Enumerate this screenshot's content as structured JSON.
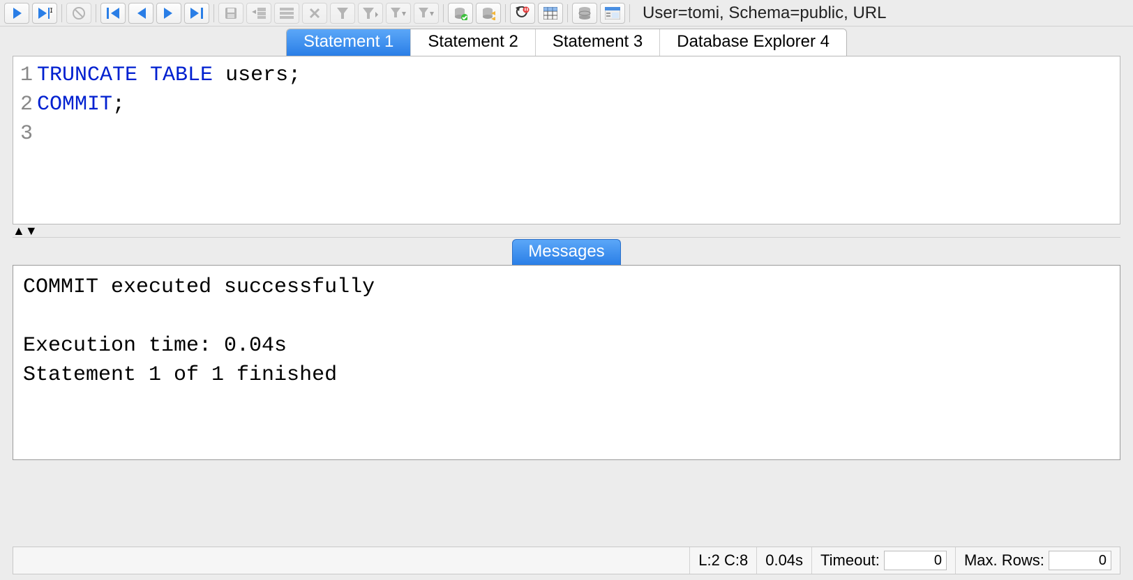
{
  "connection_info": "User=tomi, Schema=public, URL",
  "tabs": [
    {
      "label": "Statement 1",
      "active": true
    },
    {
      "label": "Statement 2",
      "active": false
    },
    {
      "label": "Statement 3",
      "active": false
    },
    {
      "label": "Database Explorer 4",
      "active": false
    }
  ],
  "editor": {
    "lines": [
      {
        "n": "1",
        "tokens": [
          {
            "t": "TRUNCATE TABLE ",
            "cls": "kw"
          },
          {
            "t": "users;",
            "cls": "id"
          }
        ]
      },
      {
        "n": "2",
        "tokens": [
          {
            "t": "COMMIT",
            "cls": "kw"
          },
          {
            "t": ";",
            "cls": "id"
          }
        ]
      },
      {
        "n": "3",
        "tokens": []
      }
    ]
  },
  "messages_tab_label": "Messages",
  "messages_body": "COMMIT executed successfully\n\nExecution time: 0.04s\nStatement 1 of 1 finished",
  "status": {
    "cursor": "L:2 C:8",
    "exec_time": "0.04s",
    "timeout_label": "Timeout:",
    "timeout_value": "0",
    "maxrows_label": "Max. Rows:",
    "maxrows_value": "0"
  },
  "icons": {
    "run": "run",
    "run_current": "run-current",
    "stop": "stop",
    "first": "first",
    "prev": "prev",
    "next": "next",
    "last": "last",
    "save": "save",
    "insert_row": "insert-row",
    "copy_row": "copy-row",
    "delete_row": "delete-row",
    "filter": "filter",
    "filter_edit": "filter-edit",
    "filter_drop": "filter-drop",
    "filter_drop2": "filter-drop2",
    "db1": "db",
    "db2": "db-flash",
    "cancel_stmt": "cancel-stmt",
    "grid": "grid",
    "dbmain": "db-main",
    "explorer": "explorer"
  }
}
